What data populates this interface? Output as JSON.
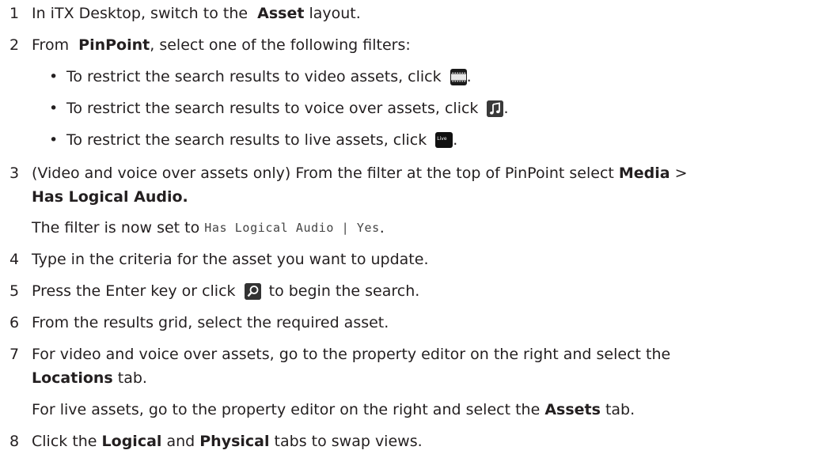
{
  "steps": [
    {
      "num": "1",
      "t1": "In iTX Desktop, switch to the ",
      "b1": "Asset",
      "t2": " layout."
    },
    {
      "num": "2",
      "t1": "From ",
      "b1": "PinPoint",
      "t2": ", select one of the following filters:"
    },
    {
      "num": "3",
      "t1": "(Video and voice over assets only) From the filter at the top of PinPoint select ",
      "b1": "Media",
      "t2": " >",
      "line2_bold": "Has Logical Audio."
    },
    {
      "num": "4",
      "t1": "Type in the criteria for the asset you want to update."
    },
    {
      "num": "5",
      "t1": "Press the Enter key or click ",
      "t2": " to begin the search."
    },
    {
      "num": "6",
      "t1": "From the results grid, select the required asset."
    },
    {
      "num": "7",
      "t1": "For video and voice over assets, go to the property editor on the right and select the",
      "line2_bold": "Locations",
      "line2_rest": " tab."
    },
    {
      "num": "8",
      "t1": "Click the ",
      "b1": "Logical",
      "t2": " and ",
      "b2": "Physical",
      "t3": " tabs to swap views."
    }
  ],
  "bullets": [
    {
      "text": "To restrict the search results to video assets, click ",
      "end": ".",
      "icon": "film-icon"
    },
    {
      "text": "To restrict the search results to voice over assets, click ",
      "end": ".",
      "icon": "music-note-icon"
    },
    {
      "text": "To restrict the search results to live assets, click ",
      "end": ".",
      "icon": "live-icon"
    }
  ],
  "bullet_char": "•",
  "filter_note": {
    "prefix": "The filter is now set to ",
    "code": "Has Logical Audio | Yes",
    "suffix": "."
  },
  "live_note": {
    "t1": "For live assets, go to the property editor on the right and select the ",
    "b1": "Assets",
    "t2": " tab."
  },
  "live_icon_text": "Live"
}
